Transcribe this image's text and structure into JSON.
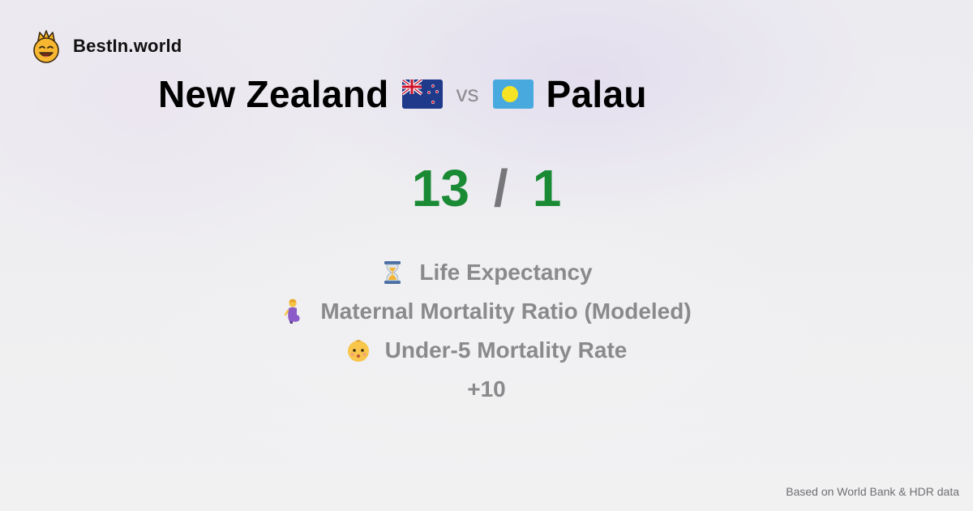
{
  "brand": {
    "name": "BestIn.world",
    "logo_icon": "smiling-crown-face-icon"
  },
  "comparison": {
    "left_country": "New Zealand",
    "left_flag_icon": "new-zealand-flag-icon",
    "vs_label": "vs",
    "right_country": "Palau",
    "right_flag_icon": "palau-flag-icon"
  },
  "score": {
    "left": "13",
    "separator": "/",
    "right": "1",
    "color": "#1a8a35"
  },
  "metrics": [
    {
      "icon": "hourglass-icon",
      "label": "Life Expectancy"
    },
    {
      "icon": "pregnant-woman-icon",
      "label": "Maternal Mortality Ratio (Modeled)"
    },
    {
      "icon": "baby-face-icon",
      "label": "Under-5 Mortality Rate"
    }
  ],
  "more_label": "+10",
  "footer": {
    "source": "Based on World Bank & HDR data"
  }
}
